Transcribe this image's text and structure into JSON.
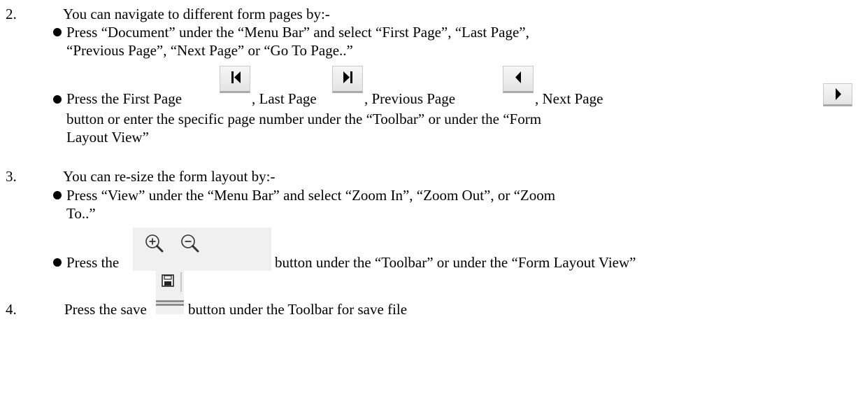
{
  "items": [
    {
      "number": "2.",
      "heading": "You can navigate to different form pages by:-",
      "bullets": {
        "b1_line1": "Press “Document” under the “Menu Bar” and select “First Page”, “Last Page”,",
        "b1_line2": "“Previous Page”, “Next Page” or “Go To Page..”",
        "b2_press_first": "Press the First Page",
        "b2_last": ", Last Page",
        "b2_prev": ", Previous Page",
        "b2_next": ", Next Page",
        "b2_line2": "button or enter the specific page number under the “Toolbar” or under the “Form",
        "b2_line3": "Layout View”"
      }
    },
    {
      "number": "3.",
      "heading": "You can re-size the form layout by:-",
      "bullets": {
        "b1_line1": "Press “View” under the “Menu Bar” and select “Zoom In”, “Zoom Out”, or “Zoom",
        "b1_line2": "To..”",
        "b2_press_the": "Press the",
        "b2_rest": "button under the “Toolbar” or under the “Form Layout View”"
      }
    },
    {
      "number": "4.",
      "press_the_save": "Press the save",
      "rest": "button under the Toolbar for save file"
    }
  ],
  "icons": {
    "first_page": "first-page-icon",
    "last_page": "last-page-icon",
    "previous_page": "previous-page-icon",
    "next_page": "next-page-icon",
    "zoom_in": "zoom-in-icon",
    "zoom_out": "zoom-out-icon",
    "save": "save-icon"
  }
}
